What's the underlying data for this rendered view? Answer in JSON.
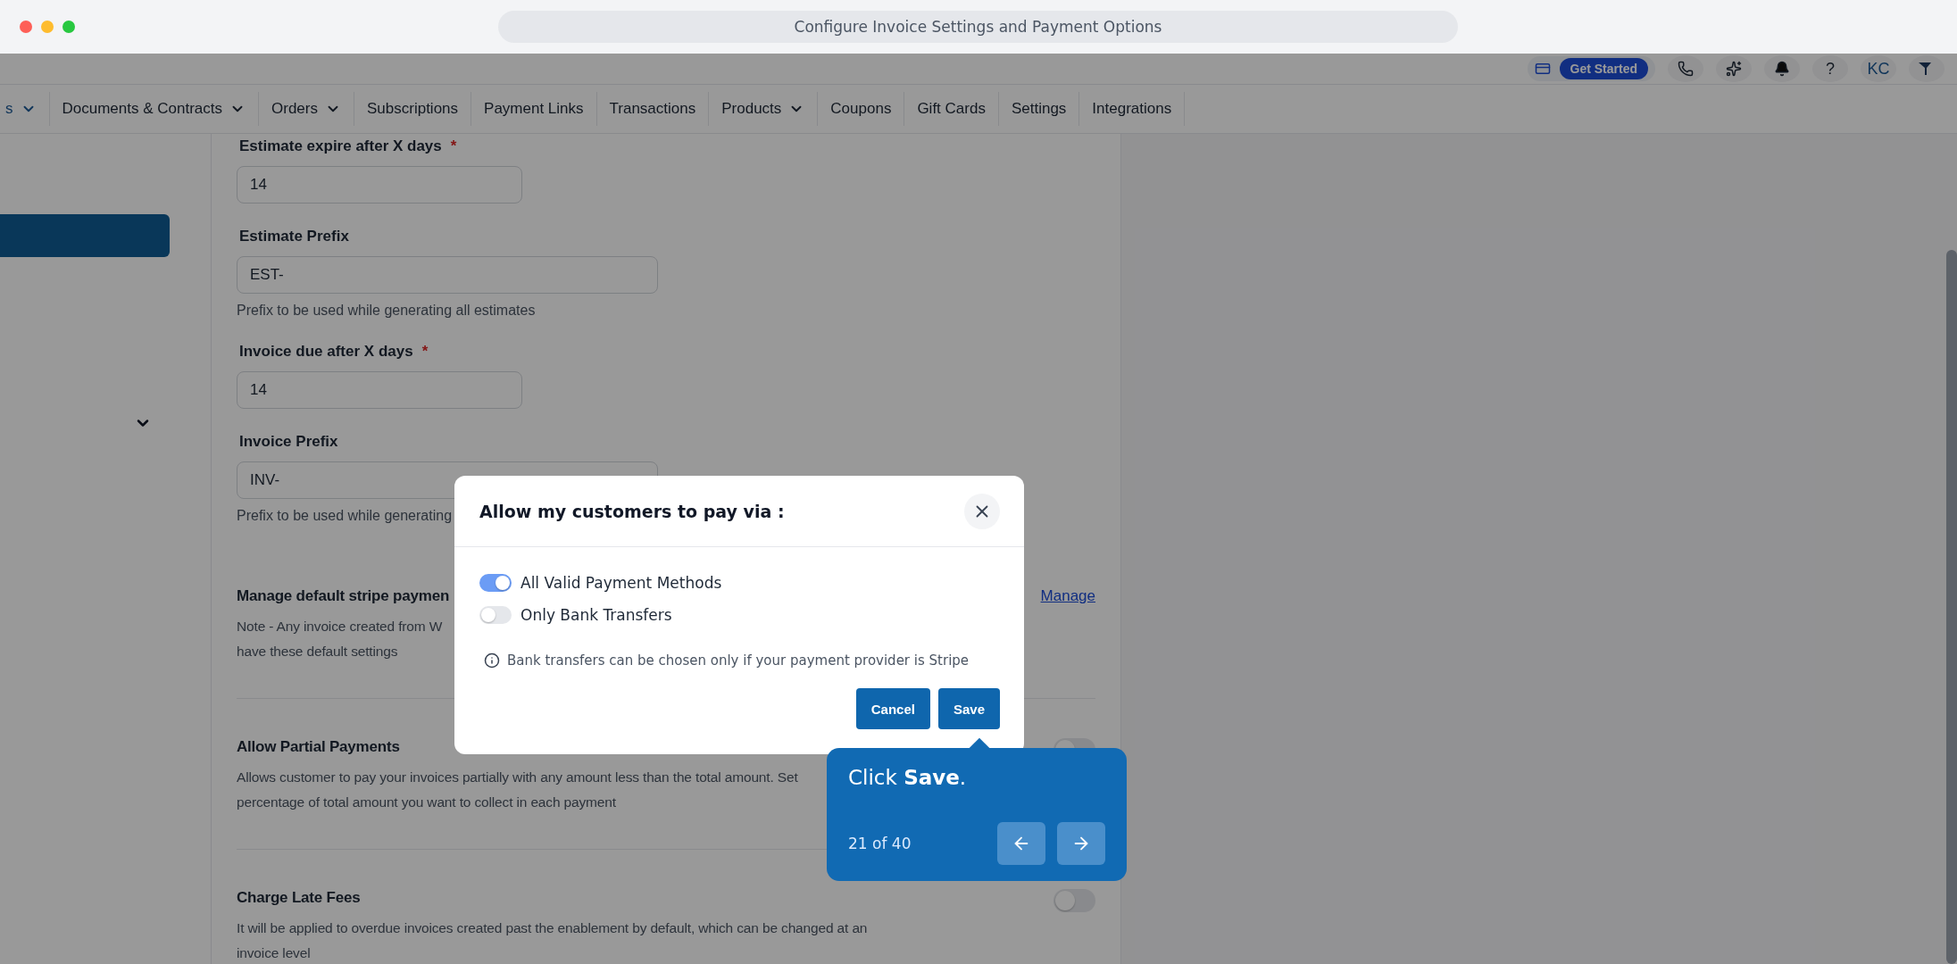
{
  "window": {
    "title": "Configure Invoice Settings and Payment Options"
  },
  "header": {
    "get_started": "Get Started",
    "help": "?",
    "avatar": "KC"
  },
  "nav": [
    {
      "label": "s",
      "dropdown": true,
      "selected": true
    },
    {
      "label": "Documents & Contracts",
      "dropdown": true,
      "selected": false
    },
    {
      "label": "Orders",
      "dropdown": true,
      "selected": false
    },
    {
      "label": "Subscriptions",
      "dropdown": false,
      "selected": false
    },
    {
      "label": "Payment Links",
      "dropdown": false,
      "selected": false
    },
    {
      "label": "Transactions",
      "dropdown": false,
      "selected": false
    },
    {
      "label": "Products",
      "dropdown": true,
      "selected": false
    },
    {
      "label": "Coupons",
      "dropdown": false,
      "selected": false
    },
    {
      "label": "Gift Cards",
      "dropdown": false,
      "selected": false
    },
    {
      "label": "Settings",
      "dropdown": false,
      "selected": false
    },
    {
      "label": "Integrations",
      "dropdown": false,
      "selected": false
    }
  ],
  "fields": [
    {
      "kind": "short",
      "label": "Estimate expire after X days",
      "required_mark": "*",
      "value": "14"
    },
    {
      "kind": "wide",
      "label": "Estimate Prefix",
      "value": "EST-",
      "help": "Prefix to be used while generating all estimates"
    },
    {
      "kind": "short",
      "label": "Invoice due after X days",
      "required_mark": "*",
      "value": "14"
    },
    {
      "kind": "wide",
      "label": "Invoice Prefix",
      "value": "INV-",
      "help": "Prefix to be used while generating"
    }
  ],
  "settings": [
    {
      "kind": "link",
      "title": "Manage default stripe paymen",
      "lines": [
        "Note - Any invoice created from W",
        "have these default settings"
      ],
      "action": "Manage"
    },
    {
      "kind": "toggle",
      "title": "Allow Partial Payments",
      "lines": [
        "Allows customer to pay your invoices partially with any amount less than the total amount. Set",
        "percentage of total amount you want to collect in each payment"
      ],
      "on": false
    },
    {
      "kind": "toggle",
      "title": "Charge Late Fees",
      "lines": [
        "It will be applied to overdue invoices created past the enablement by default, which can be changed at an",
        "invoice level"
      ],
      "on": false
    }
  ],
  "dialog": {
    "title": "Allow my customers to pay via :",
    "options": [
      {
        "label": "All Valid Payment Methods",
        "on": true
      },
      {
        "label": "Only Bank Transfers",
        "on": false
      }
    ],
    "note": "Bank transfers can be chosen only if your payment provider is Stripe",
    "buttons": [
      "Cancel",
      "Save"
    ]
  },
  "guide": {
    "text": "Click **Save**.",
    "step": "21 of 40"
  }
}
